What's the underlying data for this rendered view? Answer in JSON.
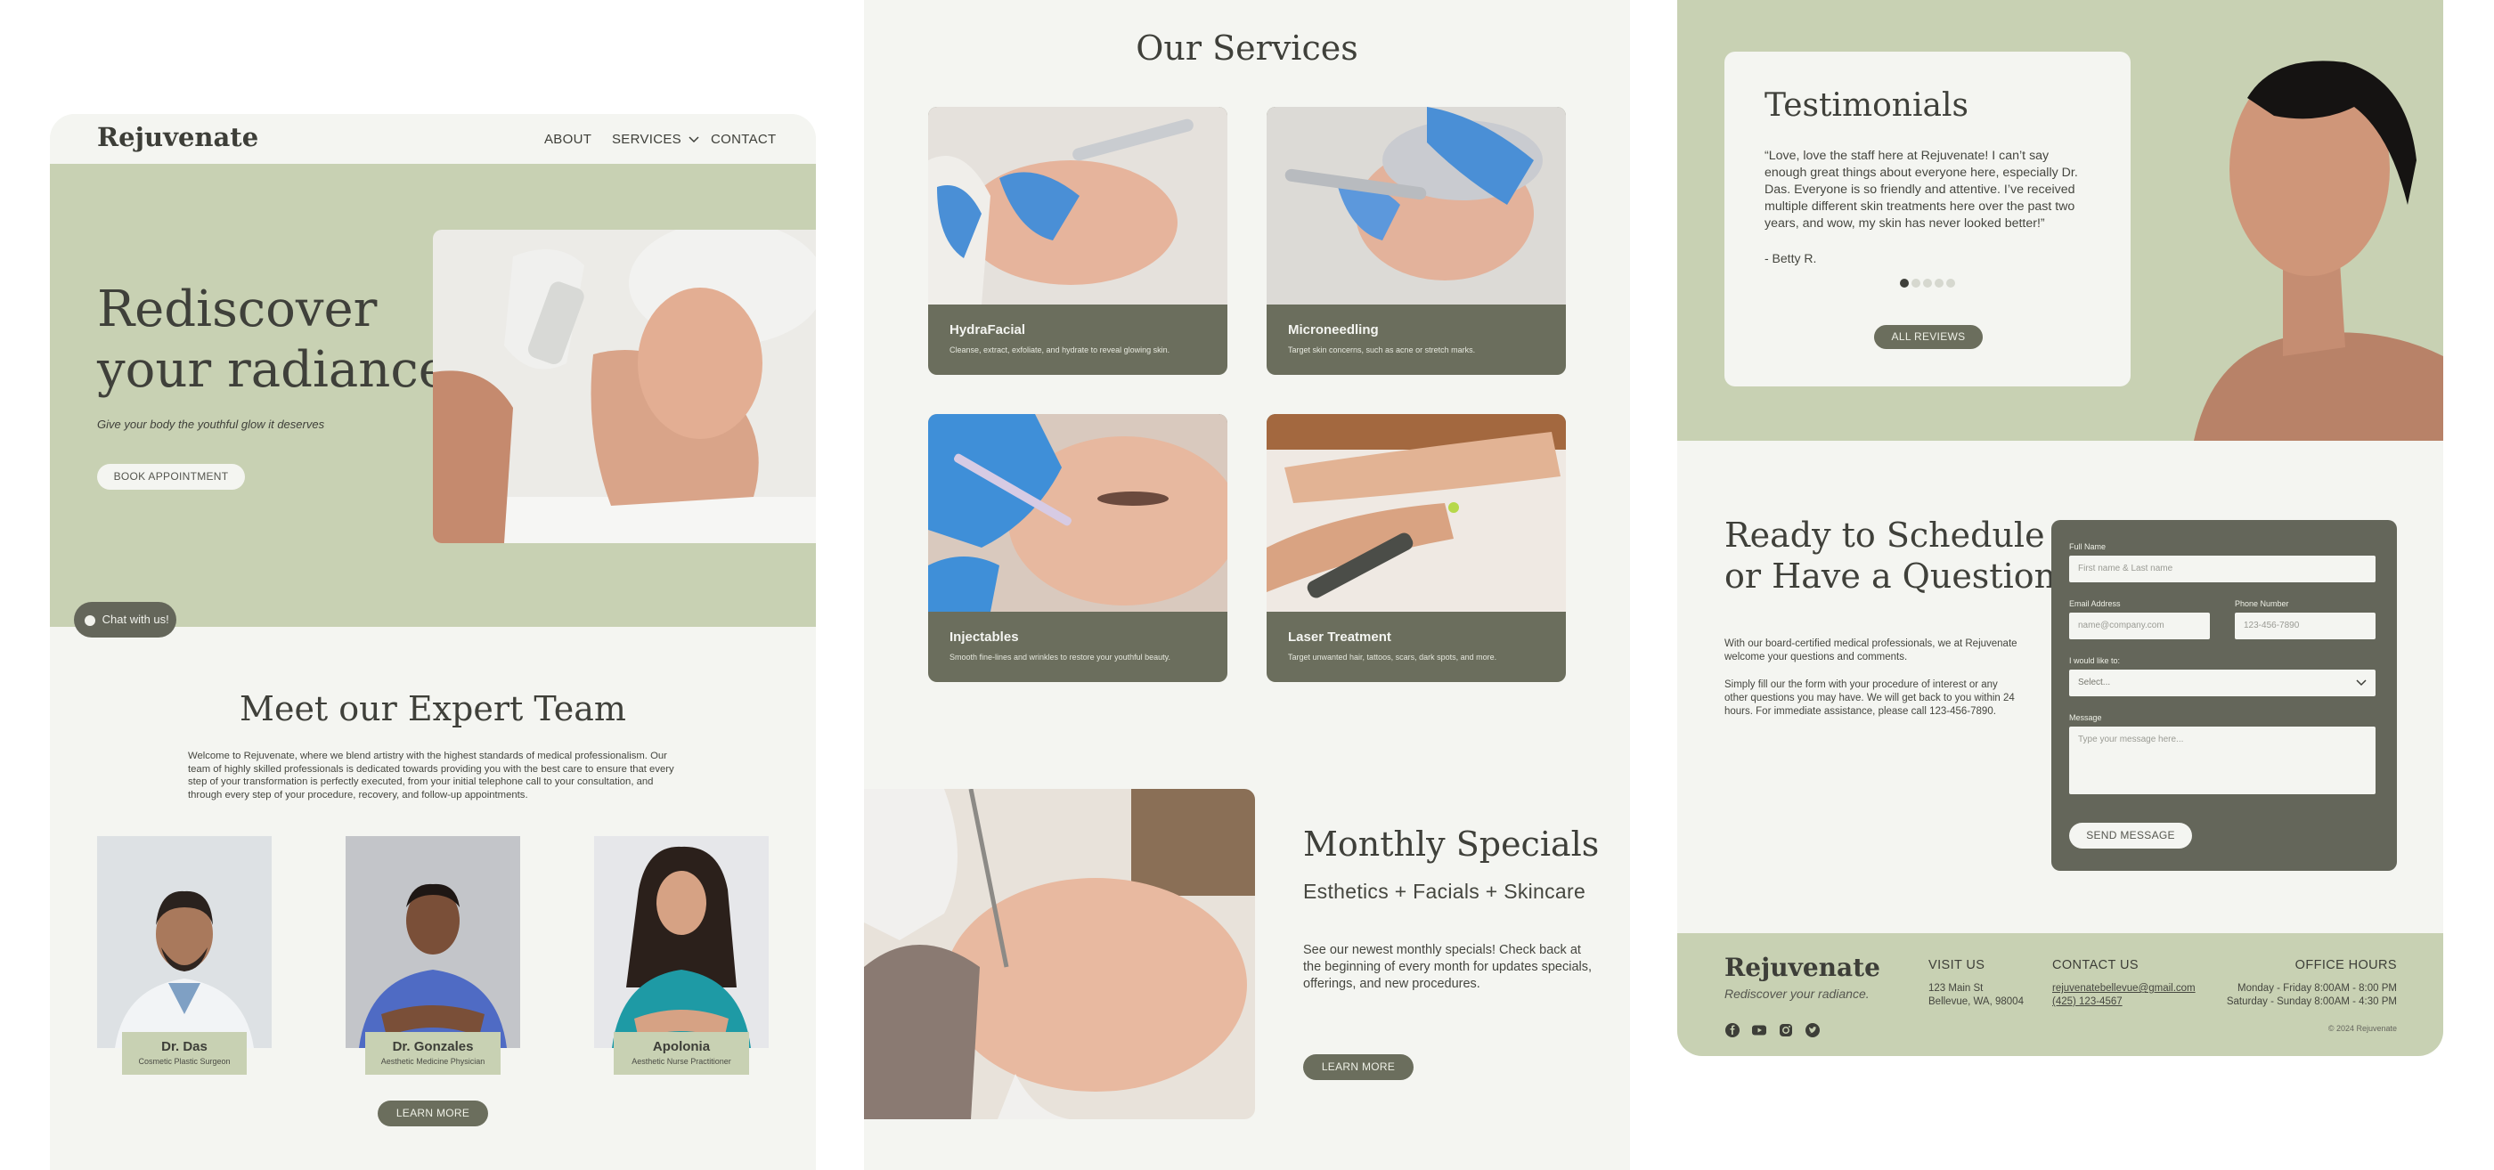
{
  "page1": {
    "brand": "Rejuvenate",
    "nav": {
      "about": "ABOUT",
      "services": "SERVICES",
      "contact": "CONTACT"
    },
    "hero": {
      "title_line1": "Rediscover",
      "title_line2": "your radiance.",
      "subtitle": "Give your body the youthful glow it deserves",
      "cta": "BOOK APPOINTMENT"
    },
    "chat": "Chat with us!",
    "team": {
      "title": "Meet our Expert Team",
      "description": "Welcome to Rejuvenate, where we blend artistry with the highest standards of medical professionalism. Our team of highly skilled professionals is dedicated towards providing you with the best care to ensure that every step of your transformation is perfectly executed, from your initial telephone call to your consultation, and through every step of your procedure, recovery, and follow-up appointments.",
      "members": [
        {
          "name": "Dr. Das",
          "role": "Cosmetic Plastic Surgeon"
        },
        {
          "name": "Dr. Gonzales",
          "role": "Aesthetic Medicine Physician"
        },
        {
          "name": "Apolonia",
          "role": "Aesthetic Nurse Practitioner"
        }
      ],
      "cta": "LEARN MORE"
    }
  },
  "page2": {
    "services_title": "Our Services",
    "services": [
      {
        "title": "HydraFacial",
        "desc": "Cleanse, extract, exfoliate, and hydrate to reveal glowing skin."
      },
      {
        "title": "Microneedling",
        "desc": "Target skin concerns, such as acne or stretch marks."
      },
      {
        "title": "Injectables",
        "desc": "Smooth fine-lines and wrinkles to restore your youthful beauty."
      },
      {
        "title": "Laser Treatment",
        "desc": "Target unwanted hair, tattoos, scars, dark spots, and more."
      }
    ],
    "specials": {
      "title": "Monthly Specials",
      "subtitle": "Esthetics + Facials + Skincare",
      "desc": "See our newest monthly specials! Check back at the beginning of every month for updates specials, offerings, and new procedures.",
      "cta": "LEARN MORE"
    }
  },
  "page3": {
    "testimonials": {
      "title": "Testimonials",
      "quote": "“Love, love the staff here at Rejuvenate! I can’t say enough great things about everyone here, especially Dr. Das. Everyone is so friendly and attentive. I’ve received multiple different skin treatments here over the past two years, and wow, my skin has never looked better!”",
      "author": "- Betty R.",
      "dots_total": 5,
      "dots_active": 1,
      "cta": "ALL REVIEWS"
    },
    "schedule": {
      "title_line1": "Ready to Schedule",
      "title_line2": "or Have a Question?",
      "p1": "With our board-certified medical professionals, we at Rejuvenate welcome your questions and comments.",
      "p2": "Simply fill our the form with your procedure of interest or any other questions you may have. We will get back to you within 24 hours. For immediate assistance, please call 123-456-7890."
    },
    "form": {
      "full_name_label": "Full Name",
      "full_name_placeholder": "First name & Last name",
      "email_label": "Email Address",
      "email_placeholder": "name@company.com",
      "phone_label": "Phone Number",
      "phone_placeholder": "123-456-7890",
      "interest_label": "I would like to:",
      "interest_value": "Select...",
      "message_label": "Message",
      "message_placeholder": "Type your message here...",
      "submit": "SEND MESSAGE"
    },
    "footer": {
      "brand": "Rejuvenate",
      "tagline": "Rediscover your radiance.",
      "visit_head": "VISIT US",
      "address1": "123 Main St",
      "address2": "Bellevue, WA, 98004",
      "contact_head": "CONTACT US",
      "email": "rejuvenatebellevue@gmail.com",
      "phone": "(425) 123-4567",
      "hours_head": "OFFICE HOURS",
      "hours1": "Monday - Friday 8:00AM - 8:00 PM",
      "hours2": "Saturday - Sunday 8:00AM - 4:30 PM",
      "copyright": "© 2024 Rejuvenate",
      "social": [
        "facebook-icon",
        "youtube-icon",
        "instagram-icon",
        "twitter-icon"
      ]
    }
  },
  "colors": {
    "sage": "#c8d1b3",
    "olive": "#6b6e5d",
    "cream": "#f4f5f1",
    "text": "#3f403a"
  }
}
